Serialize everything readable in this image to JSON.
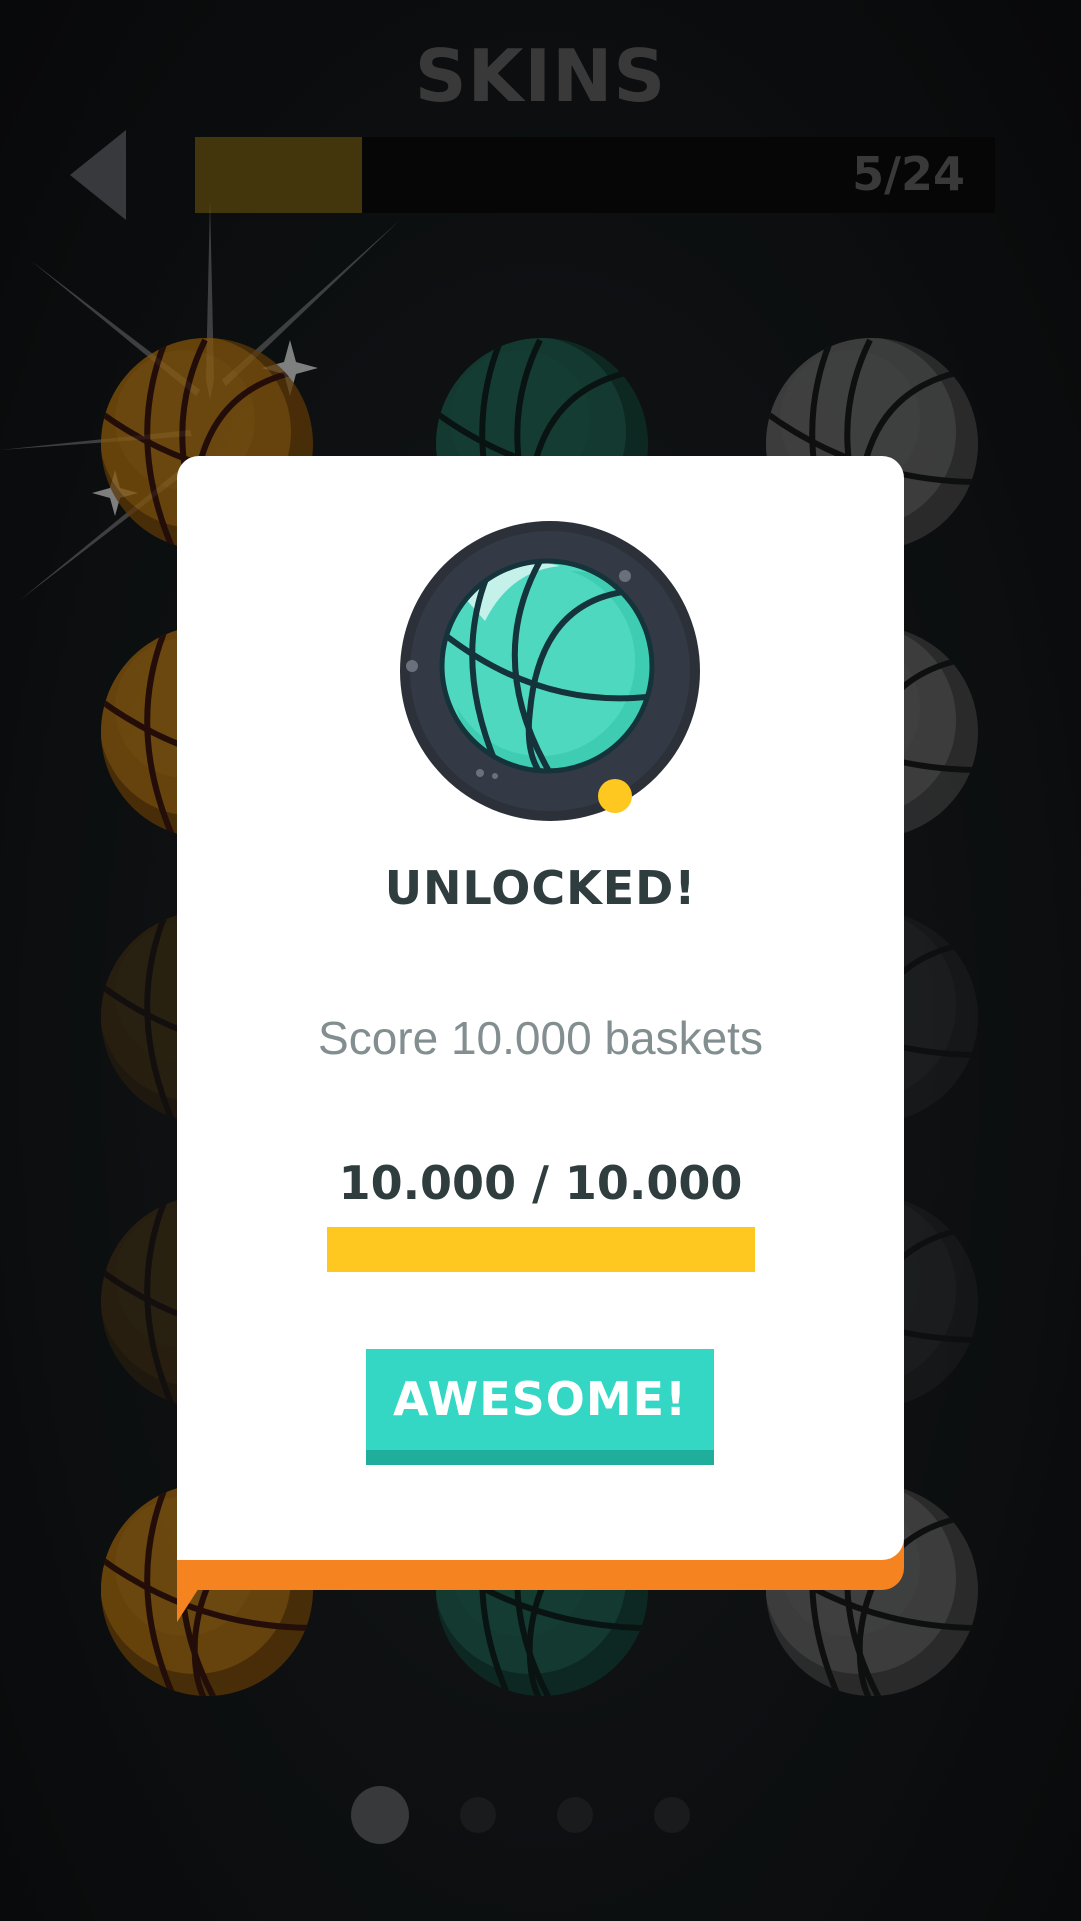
{
  "header": {
    "title": "SKINS",
    "progress_text": "5/24",
    "progress_fraction": 0.2083
  },
  "colors": {
    "background": "#0e1012",
    "title_text": "#4d4d4d",
    "progress_fill": "#5a4810",
    "modal_bg": "#ffffff",
    "modal_shadow": "#f5831f",
    "heading_text": "#2f3d3f",
    "desc_text": "#828e90",
    "bar_fill": "#fec820",
    "button_bg": "#34d6c4",
    "button_shadow": "#1fae9c"
  },
  "skins_grid": {
    "rows": [
      [
        "orange",
        "green",
        "gray"
      ],
      [
        "orange",
        "gray",
        "gray"
      ],
      [
        "orange-dim",
        "gray-dim",
        "gray-dim"
      ],
      [
        "orange-dim",
        "gray-dim",
        "gray-dim"
      ],
      [
        "orange",
        "green",
        "gray"
      ]
    ],
    "selected_index": 0
  },
  "pager": {
    "pages": 4,
    "active": 0
  },
  "modal": {
    "icon": "teal-basketball-icon",
    "heading": "UNLOCKED!",
    "description": "Score 10.000 baskets",
    "progress_text": "10.000 / 10.000",
    "progress_fraction": 1.0,
    "button_label": "AWESOME!"
  }
}
